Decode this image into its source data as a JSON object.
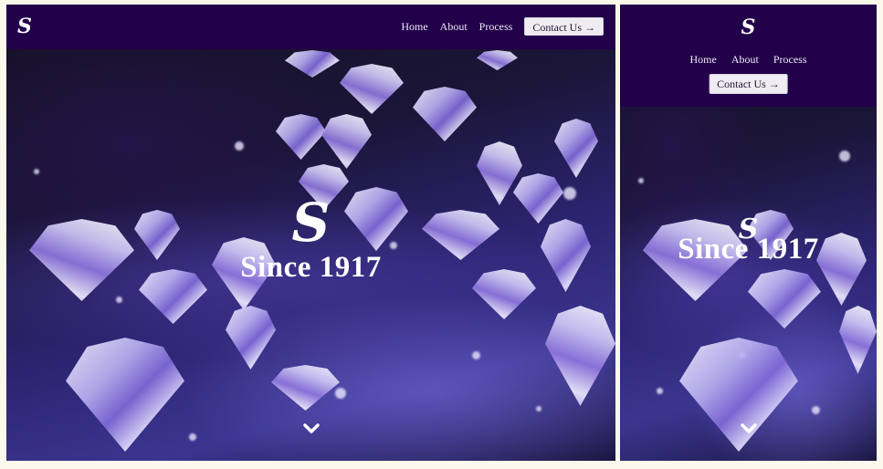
{
  "brand": {
    "logo_glyph": "S",
    "icon": "monogram-s-icon"
  },
  "navbar": {
    "background": "#22004a",
    "links": [
      "Home",
      "About",
      "Process"
    ],
    "contact_label": "Contact Us",
    "contact_icon": "arrow-right-icon",
    "contact_arrow": "→"
  },
  "hero": {
    "monogram": "S",
    "title": "Since 1917",
    "scroll_icon": "chevron-down-icon"
  }
}
